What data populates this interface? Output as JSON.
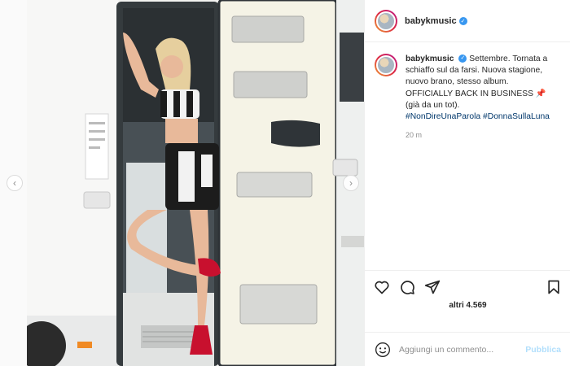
{
  "post": {
    "username": "babykmusic",
    "verified": true,
    "image_alt": "",
    "caption": {
      "username": "babykmusic",
      "lines": [
        "Settembre. Tornata a",
        "schiaffo sul da farsi. Nuova stagione,",
        "nuovo brano, stesso album.",
        "OFFICIALLY BACK IN BUSINESS 📌",
        "(già da un tot)."
      ],
      "hashtags": [
        "#NonDireUnaParola",
        "#DonnaSullaLuna"
      ]
    },
    "time_ago": "20 m",
    "likes": "altri 4.569"
  },
  "comment": {
    "placeholder": "Aggiungi un commento...",
    "publish_label": "Pubblica"
  },
  "icons": {
    "like": "heart-icon",
    "comment": "comment-icon",
    "share": "paper-plane-icon",
    "save": "bookmark-icon",
    "emoji": "emoji-icon",
    "prev": "chevron-left-icon",
    "next": "chevron-right-icon"
  }
}
